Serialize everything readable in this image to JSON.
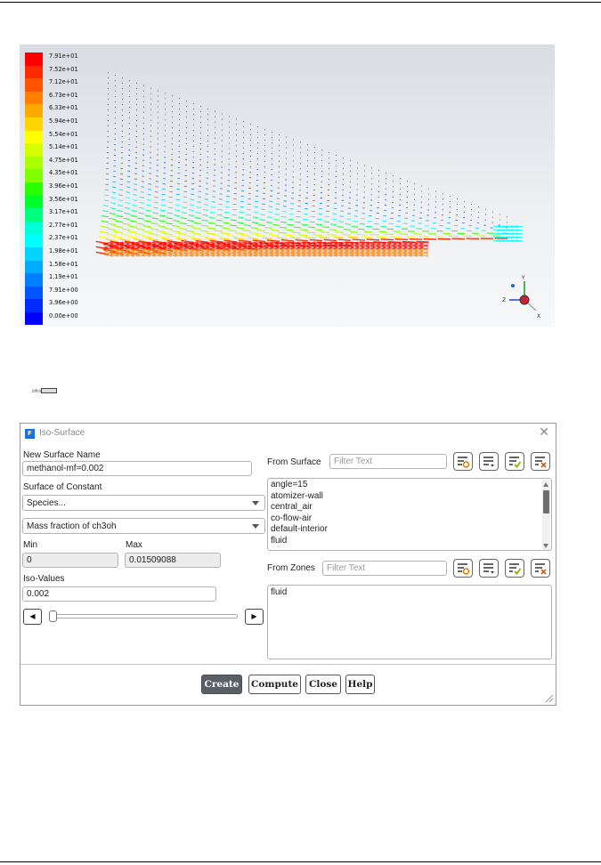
{
  "plot": {
    "colorbar_labels": [
      "7.91e+01",
      "7.52e+01",
      "7.12e+01",
      "6.73e+01",
      "6.33e+01",
      "5.94e+01",
      "5.54e+01",
      "5.14e+01",
      "4.75e+01",
      "4.35e+01",
      "3.96e+01",
      "3.56e+01",
      "3.17e+01",
      "2.77e+01",
      "2.37e+01",
      "1.98e+01",
      "1.58e+01",
      "1.19e+01",
      "7.91e+00",
      "3.96e+00",
      "0.00e+00"
    ],
    "colorbar_colors": [
      "#ff0000",
      "#ff2a00",
      "#ff5500",
      "#ff7f00",
      "#ffaa00",
      "#ffd400",
      "#ffff00",
      "#d4ff00",
      "#aaff00",
      "#7fff00",
      "#2aff00",
      "#00ff2a",
      "#00ff7f",
      "#00ffd4",
      "#00ffff",
      "#00d4ff",
      "#00aaff",
      "#007fff",
      "#0055ff",
      "#002aff",
      "#0000ff"
    ],
    "triad_labels": {
      "y": "Y",
      "z": "Z",
      "x": "X"
    }
  },
  "caption_small": "bffilme",
  "dialog": {
    "title": "Iso-Surface",
    "logo_letter": "F",
    "new_surface_name_label": "New Surface Name",
    "new_surface_name_value": "methanol-mf=0.002",
    "surface_of_constant_label": "Surface of Constant",
    "category_value": "Species...",
    "quantity_value": "Mass fraction of ch3oh",
    "min_label": "Min",
    "max_label": "Max",
    "min_value": "0",
    "max_value": "0.01509088",
    "iso_values_label": "Iso-Values",
    "iso_values_value": "0.002",
    "from_surface_label": "From Surface",
    "from_surface_filter_placeholder": "Filter Text",
    "from_surface_items": [
      "angle=15",
      "atomizer-wall",
      "central_air",
      "co-flow-air",
      "default-interior",
      "fluid"
    ],
    "from_zones_label": "From Zones",
    "from_zones_filter_placeholder": "Filter Text",
    "from_zones_items": [
      "fluid"
    ],
    "buttons": {
      "create": "Create",
      "compute": "Compute",
      "close": "Close",
      "help": "Help"
    }
  }
}
